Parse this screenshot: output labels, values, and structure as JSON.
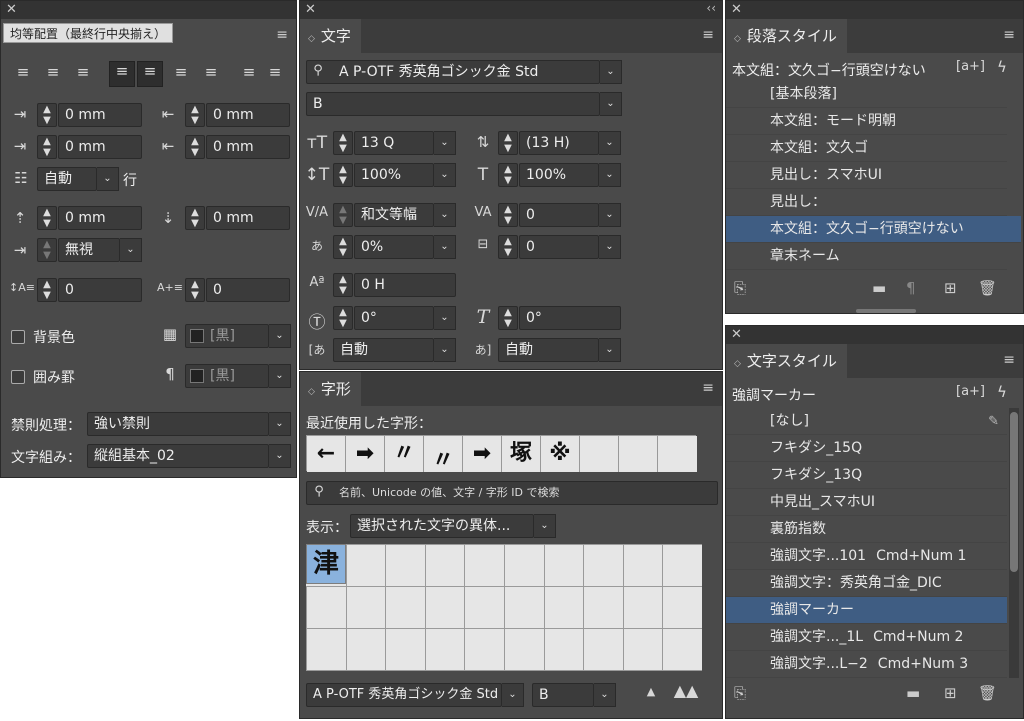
{
  "left_panel": {
    "title": "均等配置（最終行中央揃え）",
    "indent": {
      "left": "0 mm",
      "right": "0 mm",
      "first": "0 mm",
      "last": "0 mm"
    },
    "grid_label": "自動",
    "grid_suffix": "行",
    "space": {
      "before": "0 mm",
      "after": "0 mm"
    },
    "grid_align": "無視",
    "drop": {
      "lines": "0",
      "chars": "0"
    },
    "bg_color_label": "背景色",
    "bg_color_val": "[黒]",
    "border_label": "囲み罫",
    "border_val": "[黒]",
    "kinsoku_label": "禁則処理：",
    "kinsoku_val": "強い禁則",
    "mojikumi_label": "文字組み：",
    "mojikumi_val": "縦組基本_02"
  },
  "char_panel": {
    "tab": "文字",
    "font": "A P-OTF 秀英角ゴシック金 Std",
    "style": "B",
    "size": "13 Q",
    "leading": "(13 H)",
    "vscale": "100%",
    "hscale": "100%",
    "kerning": "和文等幅",
    "tracking": "0",
    "tsume": "0%",
    "aki": "0",
    "baseline": "0 H",
    "rotate": "0°",
    "skew": "0°",
    "aki_before": "自動",
    "aki_after": "自動"
  },
  "glyph_panel": {
    "tab": "字形",
    "recent_label": "最近使用した字形：",
    "recent": [
      "←",
      "➡",
      "〃",
      "〃",
      "➡",
      "塚",
      "※",
      "",
      "",
      ""
    ],
    "search_placeholder": "名前、Unicode の値、文字 / 字形 ID で検索",
    "show_label": "表示：",
    "show_val": "選択された文字の異体...",
    "selected_glyph": "津",
    "font": "A P-OTF 秀英角ゴシック金 Std",
    "style": "B"
  },
  "para_styles": {
    "tab": "段落スタイル",
    "current": "本文組：文久ゴ−行頭空けない",
    "items": [
      "[基本段落]",
      "本文組：モード明朝",
      "本文組：文久ゴ",
      "見出し：スマホUI",
      "見出し：",
      "本文組：文久ゴ−行頭空けない",
      "章末ネーム"
    ],
    "selected_index": 5
  },
  "char_styles": {
    "tab": "文字スタイル",
    "current": "強調マーカー",
    "items": [
      {
        "name": "[なし]",
        "shortcut": ""
      },
      {
        "name": "フキダシ_15Q",
        "shortcut": ""
      },
      {
        "name": "フキダシ_13Q",
        "shortcut": ""
      },
      {
        "name": "中見出_スマホUI",
        "shortcut": ""
      },
      {
        "name": "裏筋指数",
        "shortcut": ""
      },
      {
        "name": "強調文字...101",
        "shortcut": "Cmd+Num 1"
      },
      {
        "name": "強調文字：秀英角ゴ金_DIC",
        "shortcut": ""
      },
      {
        "name": "強調マーカー",
        "shortcut": ""
      },
      {
        "name": "強調文字..._1L",
        "shortcut": "Cmd+Num 2"
      },
      {
        "name": "強調文字...L−2",
        "shortcut": "Cmd+Num 3"
      }
    ],
    "selected_index": 7
  }
}
